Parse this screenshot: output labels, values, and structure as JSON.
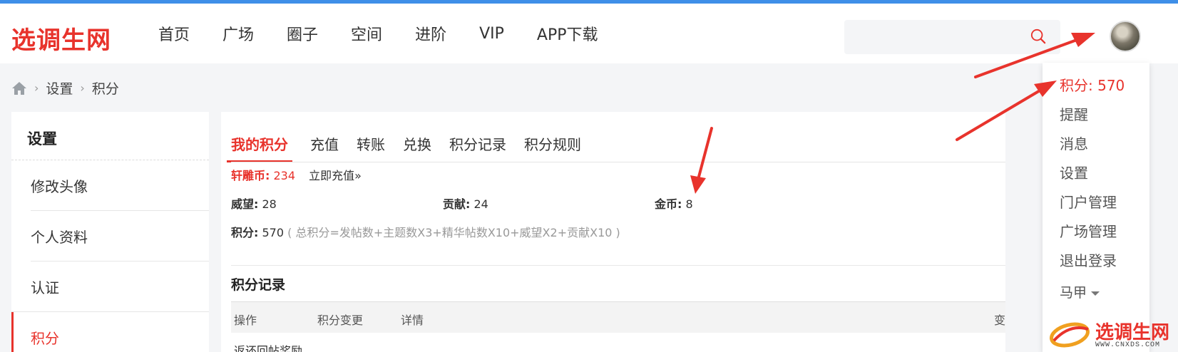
{
  "header": {
    "logo_text": "选调生网",
    "nav": [
      "首页",
      "广场",
      "圈子",
      "空间",
      "进阶",
      "VIP",
      "APP下载"
    ],
    "search_placeholder": ""
  },
  "breadcrumb": {
    "items": [
      "设置",
      "积分"
    ]
  },
  "sidebar": {
    "title": "设置",
    "items": [
      "修改头像",
      "个人资料",
      "认证",
      "积分"
    ],
    "active_index": 3
  },
  "main": {
    "tabs": [
      "我的积分",
      "充值",
      "转账",
      "兑换",
      "积分记录",
      "积分规则"
    ],
    "active_tab": 0,
    "coin_label": "轩雕币:",
    "coin_value": "234",
    "recharge_link": "立即充值»",
    "stats": {
      "prestige_label": "威望:",
      "prestige_value": "28",
      "contrib_label": "贡献:",
      "contrib_value": "24",
      "gold_label": "金币:",
      "gold_value": "8"
    },
    "points_label": "积分:",
    "points_value": "570",
    "points_formula": "( 总积分=发帖数+主题数X3+精华帖数X10+威望X2+贡献X10 )",
    "record_title": "积分记录",
    "table_headers": [
      "操作",
      "积分变更",
      "详情",
      "变"
    ],
    "first_row": "返还回帖奖励"
  },
  "dropdown": {
    "points": "积分: 570",
    "items": [
      "提醒",
      "消息",
      "设置",
      "门户管理",
      "广场管理",
      "退出登录"
    ],
    "user": "马甲"
  },
  "watermark": {
    "text": "选调生网",
    "url": "WWW.CNXDS.COM"
  },
  "colors": {
    "accent": "#e8332c",
    "topbar": "#3f8fe8"
  }
}
